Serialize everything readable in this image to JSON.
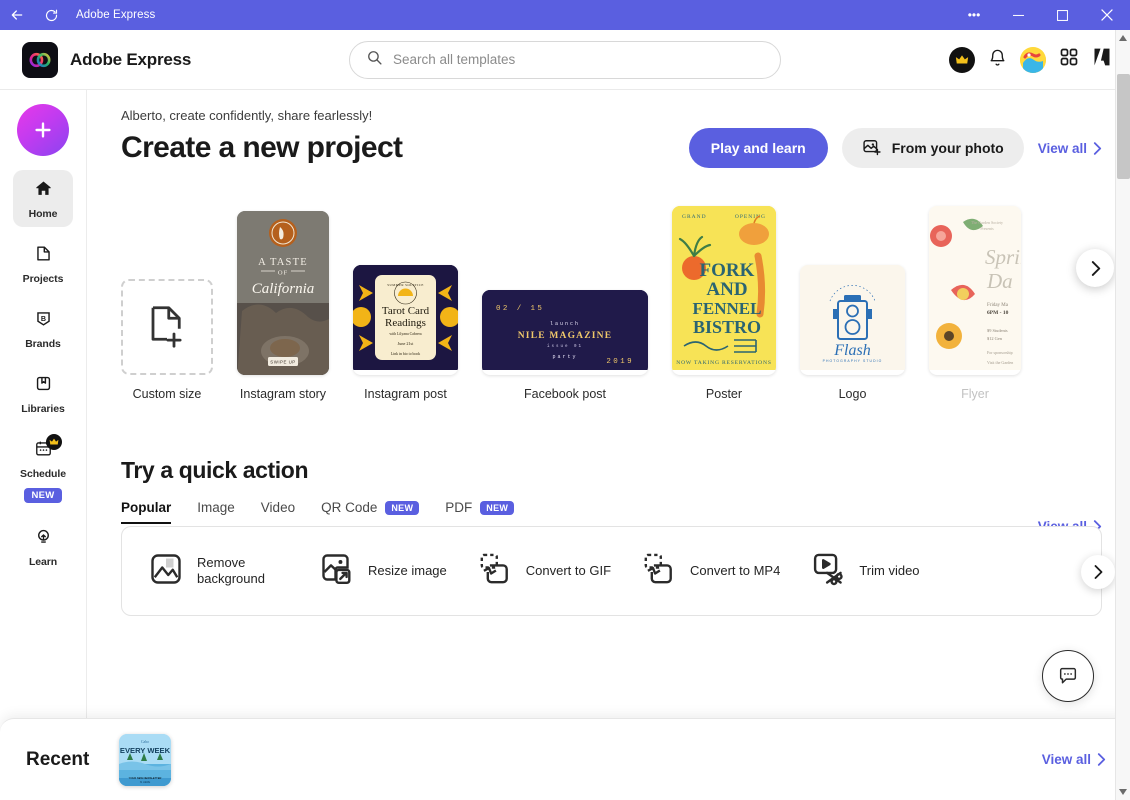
{
  "titlebar": {
    "title": "Adobe Express",
    "back_icon": "back-arrow-icon",
    "refresh_icon": "refresh-icon",
    "more_label": "•••",
    "minimize_label": "─",
    "maximize_label": "☐",
    "close_label": "✕"
  },
  "header": {
    "brand_name": "Adobe Express",
    "search_placeholder": "Search all templates",
    "search_value": "",
    "icons": [
      "premium-crown-icon",
      "notifications-bell-icon",
      "user-avatar",
      "app-switcher-icon",
      "adobe-logo-icon"
    ]
  },
  "sidebar": {
    "create_button_label": "+",
    "items": [
      {
        "label": "Home",
        "icon": "home-icon",
        "active": true
      },
      {
        "label": "Projects",
        "icon": "document-icon",
        "active": false
      },
      {
        "label": "Brands",
        "icon": "brand-shield-icon",
        "active": false
      },
      {
        "label": "Libraries",
        "icon": "library-book-icon",
        "active": false
      },
      {
        "label": "Schedule",
        "icon": "calendar-icon",
        "active": false,
        "badge": "NEW",
        "premium": true
      },
      {
        "label": "Learn",
        "icon": "lightbulb-icon",
        "active": false
      }
    ]
  },
  "main": {
    "greeting": "Alberto, create confidently, share fearlessly!",
    "page_title": "Create a new project",
    "play_and_learn_label": "Play and learn",
    "from_your_photo_label": "From your photo",
    "view_all_label": "View all",
    "next_arrow_icon": "chevron-right-icon",
    "templates": [
      {
        "label": "Custom size",
        "type": "custom"
      },
      {
        "label": "Instagram story",
        "type": "story",
        "art_title": "A TASTE",
        "art_sub": "OF",
        "art_script": "California",
        "art_cta": "SWIPE UP"
      },
      {
        "label": "Instagram post",
        "type": "igpost",
        "art_badge": "SUMMER SOLSTICE",
        "art_title": "Tarot Card",
        "art_title2": "Readings",
        "art_sub": "with Lilyana Cabrera",
        "art_date": "June 21st",
        "art_cta": "Link in bio to book"
      },
      {
        "label": "Facebook post",
        "type": "fbpost",
        "art_tl": "02 / 15",
        "art_k": "launch",
        "art_title": "NILE MAGAZINE",
        "art_sub": "issue 01",
        "art_sub2": "party",
        "art_br": "2019"
      },
      {
        "label": "Poster",
        "type": "poster",
        "art_tl": "GRAND",
        "art_tr": "OPENING",
        "art_l1": "FORK",
        "art_l2": "AND",
        "art_l3": "FENNEL",
        "art_l4": "BISTRO",
        "art_bottom": "NOW TAKING RESERVATIONS"
      },
      {
        "label": "Logo",
        "type": "logo",
        "art_arc": "PHOTOGRAPHY STUDIO",
        "art_title": "Flash",
        "art_sub": "PHOTOGRAPHY STUDIO"
      },
      {
        "label": "Flyer",
        "type": "flyer",
        "art_title": "Sprin",
        "art_title2": "Da",
        "art_line": "Friday Ma",
        "art_line2": "6PM – 10"
      }
    ]
  },
  "quick_action": {
    "title": "Try a quick action",
    "view_all_label": "View all",
    "tabs": [
      {
        "label": "Popular",
        "active": true
      },
      {
        "label": "Image",
        "active": false
      },
      {
        "label": "Video",
        "active": false
      },
      {
        "label": "QR Code",
        "active": false,
        "badge": "NEW"
      },
      {
        "label": "PDF",
        "active": false,
        "badge": "NEW"
      }
    ],
    "items": [
      {
        "label": "Remove background",
        "icon": "remove-background-icon"
      },
      {
        "label": "Resize image",
        "icon": "resize-image-icon"
      },
      {
        "label": "Convert to GIF",
        "icon": "convert-to-gif-icon"
      },
      {
        "label": "Convert to MP4",
        "icon": "convert-to-mp4-icon"
      },
      {
        "label": "Trim video",
        "icon": "trim-video-icon"
      }
    ],
    "next_arrow_icon": "chevron-right-icon"
  },
  "recent": {
    "title": "Recent",
    "view_all_label": "View all",
    "items": [
      {
        "name": "Cabo",
        "line1": "Cabo",
        "line2": "EVERY WEEK",
        "line3": "YOUR NEW NEWSLETTER",
        "line4": "IS HERE"
      }
    ]
  },
  "chat": {
    "icon": "chat-bubble-icon"
  },
  "colors": {
    "titlebar": "#5A5FE0",
    "accent": "#5A5FE0",
    "badge_new": "#5A5FE0"
  }
}
